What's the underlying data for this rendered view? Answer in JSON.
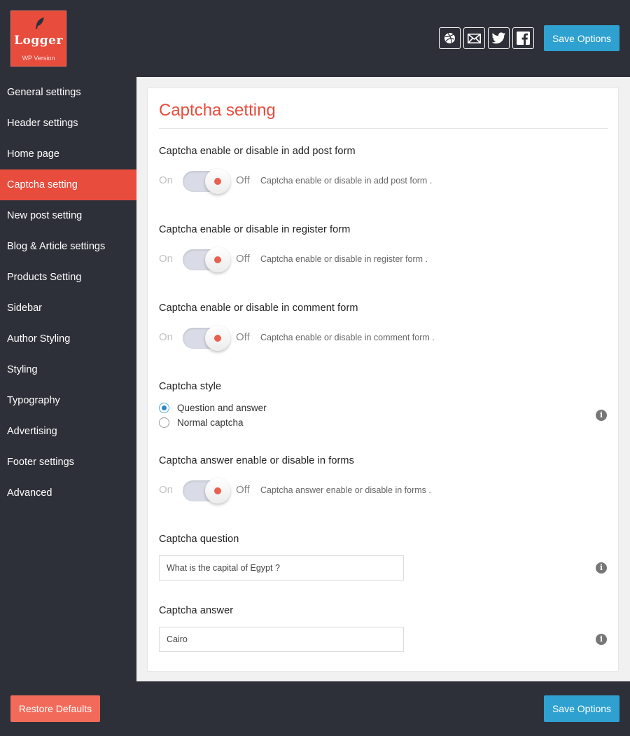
{
  "logo": {
    "name": "Logger",
    "version": "WP Version"
  },
  "header": {
    "social": [
      "dribbble-icon",
      "mail-icon",
      "twitter-icon",
      "facebook-icon"
    ],
    "save_label": "Save Options"
  },
  "sidebar": {
    "items": [
      {
        "label": "General settings"
      },
      {
        "label": "Header settings"
      },
      {
        "label": "Home page"
      },
      {
        "label": "Captcha setting"
      },
      {
        "label": "New post setting"
      },
      {
        "label": "Blog & Article settings"
      },
      {
        "label": "Products Setting"
      },
      {
        "label": "Sidebar"
      },
      {
        "label": "Author Styling"
      },
      {
        "label": "Styling"
      },
      {
        "label": "Typography"
      },
      {
        "label": "Advertising"
      },
      {
        "label": "Footer settings"
      },
      {
        "label": "Advanced"
      }
    ],
    "active_index": 3
  },
  "page": {
    "title": "Captcha setting"
  },
  "toggles": [
    {
      "title": "Captcha enable or disable in add post form",
      "on": "On",
      "off": "Off",
      "desc": "Captcha enable or disable in add post form .",
      "state": "off"
    },
    {
      "title": "Captcha enable or disable in register form",
      "on": "On",
      "off": "Off",
      "desc": "Captcha enable or disable in register form .",
      "state": "off"
    },
    {
      "title": "Captcha enable or disable in comment form",
      "on": "On",
      "off": "Off",
      "desc": "Captcha enable or disable in comment form .",
      "state": "off"
    }
  ],
  "captcha_style": {
    "title": "Captcha style",
    "options": [
      {
        "label": "Question and answer",
        "checked": true
      },
      {
        "label": "Normal captcha",
        "checked": false
      }
    ]
  },
  "answer_toggle": {
    "title": "Captcha answer enable or disable in forms",
    "on": "On",
    "off": "Off",
    "desc": "Captcha answer enable or disable in forms .",
    "state": "off"
  },
  "question": {
    "title": "Captcha question",
    "value": "What is the capital of Egypt ?"
  },
  "answer": {
    "title": "Captcha answer",
    "value": "Cairo"
  },
  "footer": {
    "restore_label": "Restore Defaults",
    "save_label": "Save Options"
  },
  "colors": {
    "accent": "#e84c3d",
    "primary_button": "#2ea1d0",
    "restore_button": "#f26b5a",
    "dark_bg": "#2e3039"
  }
}
